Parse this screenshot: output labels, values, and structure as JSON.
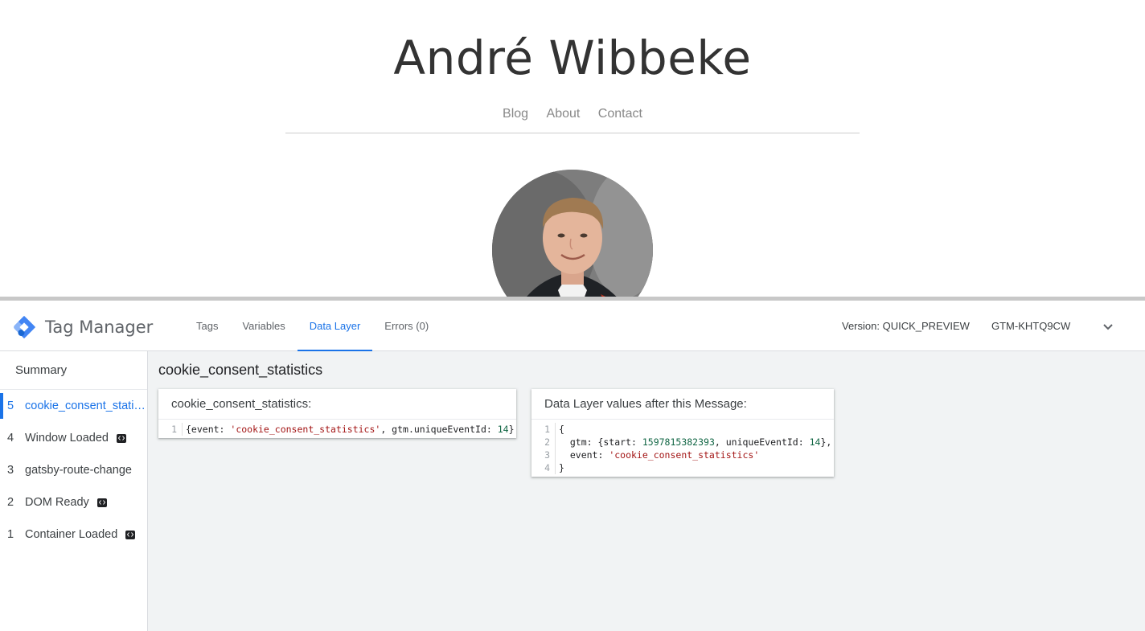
{
  "site": {
    "title": "André Wibbeke",
    "nav": [
      "Blog",
      "About",
      "Contact"
    ]
  },
  "gtm": {
    "brand": "Tag Manager",
    "tabs": [
      {
        "label": "Tags"
      },
      {
        "label": "Variables"
      },
      {
        "label": "Data Layer",
        "active": true
      },
      {
        "label": "Errors (0)"
      }
    ],
    "version": "Version: QUICK_PREVIEW",
    "container_id": "GTM-KHTQ9CW",
    "sidebar": {
      "summary": "Summary",
      "items": [
        {
          "num": "5",
          "label": "cookie_consent_statistics",
          "active": true,
          "badge": false
        },
        {
          "num": "4",
          "label": "Window Loaded",
          "badge": true
        },
        {
          "num": "3",
          "label": "gatsby-route-change",
          "badge": false
        },
        {
          "num": "2",
          "label": "DOM Ready",
          "badge": true
        },
        {
          "num": "1",
          "label": "Container Loaded",
          "badge": true
        }
      ]
    },
    "main": {
      "title": "cookie_consent_statistics",
      "message_card": {
        "heading": "cookie_consent_statistics:",
        "lines": [
          [
            {
              "t": "{event: "
            },
            {
              "t": "'cookie_consent_statistics'",
              "c": "str"
            },
            {
              "t": ", gtm.uniqueEventId: "
            },
            {
              "t": "14",
              "c": "numv"
            },
            {
              "t": "}"
            }
          ]
        ]
      },
      "values_card": {
        "heading": "Data Layer values after this Message:",
        "lines": [
          [
            {
              "t": "{"
            }
          ],
          [
            {
              "t": "  gtm: {start: "
            },
            {
              "t": "1597815382393",
              "c": "numv"
            },
            {
              "t": ", uniqueEventId: "
            },
            {
              "t": "14",
              "c": "numv"
            },
            {
              "t": "},"
            }
          ],
          [
            {
              "t": "  event: "
            },
            {
              "t": "'cookie_consent_statistics'",
              "c": "str"
            }
          ],
          [
            {
              "t": "}"
            }
          ]
        ]
      }
    },
    "colors": {
      "accent": "#1a73e8",
      "string": "#a31515",
      "number": "#116644"
    }
  }
}
